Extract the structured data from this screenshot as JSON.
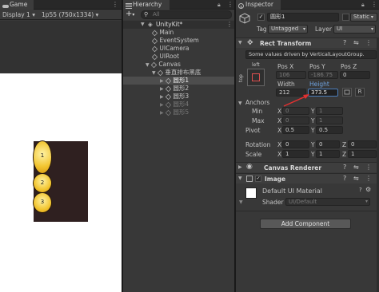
{
  "game": {
    "tab": "Game",
    "display": "Display 1",
    "resolution": "1p55 (750x1334)"
  },
  "preview": {
    "items": [
      "1",
      "2",
      "3"
    ]
  },
  "hierarchy": {
    "tab": "Hierarchy",
    "add": "+",
    "search": "All",
    "scene": "UnityKit*",
    "items": [
      {
        "label": "Main"
      },
      {
        "label": "EventSystem"
      },
      {
        "label": "UICamera"
      },
      {
        "label": "UIRoot"
      },
      {
        "label": "Canvas"
      },
      {
        "label": "垂直排布黑底"
      },
      {
        "label": "圆形1"
      },
      {
        "label": "圆形2"
      },
      {
        "label": "圆形3"
      },
      {
        "label": "圆形4"
      },
      {
        "label": "圆形5"
      }
    ]
  },
  "inspector": {
    "tab": "Inspector",
    "name": "圆形1",
    "static_label": "Static",
    "tag_label": "Tag",
    "tag_value": "Untagged",
    "layer_label": "Layer",
    "layer_value": "UI",
    "rect_transform": {
      "title": "Rect Transform",
      "note": "Some values driven by VerticalLayoutGroup.",
      "anchor_h": "left",
      "anchor_v": "top",
      "posx_label": "Pos X",
      "posy_label": "Pos Y",
      "posz_label": "Pos Z",
      "posx": "106",
      "posy": "-186.75",
      "posz": "0",
      "width_label": "Width",
      "height_label": "Height",
      "width": "212",
      "height": "373.5",
      "anchors": "Anchors",
      "min": "Min",
      "max": "Max",
      "pivot": "Pivot",
      "min_x": "0",
      "min_y": "1",
      "max_x": "0",
      "max_y": "1",
      "pivot_x": "0.5",
      "pivot_y": "0.5",
      "rotation": "Rotation",
      "scale": "Scale",
      "rot_x": "0",
      "rot_y": "0",
      "rot_z": "0",
      "scale_x": "1",
      "scale_y": "1",
      "scale_z": "1",
      "x": "X",
      "y": "Y",
      "z": "Z",
      "r": "R"
    },
    "canvas_renderer": "Canvas Renderer",
    "image": {
      "title": "Image",
      "material": "Default UI Material",
      "shader_label": "Shader",
      "shader_value": "UI/Default"
    },
    "add_component": "Add Component"
  },
  "colors": {
    "accent": "#4d7fbd",
    "red_arrow": "#e03030",
    "circle": "#f2c530"
  }
}
